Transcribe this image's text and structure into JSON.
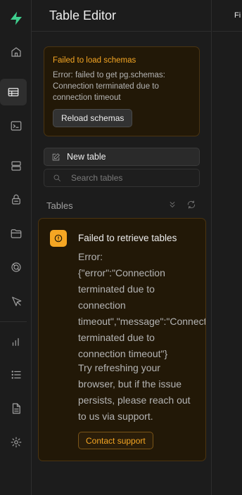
{
  "rail": {
    "items": [
      {
        "icon": "supabase-logo-icon"
      },
      {
        "icon": "home-icon"
      },
      {
        "icon": "table-editor-icon",
        "active": true
      },
      {
        "icon": "sql-editor-icon"
      },
      {
        "icon": "database-icon"
      },
      {
        "icon": "auth-lock-icon"
      },
      {
        "icon": "storage-folder-icon"
      },
      {
        "icon": "realtime-icon"
      },
      {
        "icon": "edge-functions-icon"
      },
      {
        "icon": "reports-icon"
      },
      {
        "icon": "logs-list-icon"
      },
      {
        "icon": "api-docs-icon"
      },
      {
        "icon": "settings-gear-icon"
      }
    ],
    "brand_color": "#3ecf8e"
  },
  "panel": {
    "title": "Table Editor",
    "schema_error": {
      "title": "Failed to load schemas",
      "message": "Error: failed to get pg.schemas: Connection terminated due to connection timeout",
      "reload_label": "Reload schemas"
    },
    "new_table_label": "New table",
    "search_placeholder": "Search tables",
    "tables_heading": "Tables",
    "tables_error": {
      "title": "Failed to retrieve tables",
      "message": "Error:\n{\"error\":\"Connection\nterminated due to\nconnection\ntimeout\",\"message\":\"Connection\nterminated due to\nconnection timeout\"}",
      "hint": "Try refreshing your browser, but if the issue persists, please reach out to us via support.",
      "contact_label": "Contact support"
    }
  },
  "right": {
    "tab_label": "Fi"
  },
  "colors": {
    "warning": "#f5a623",
    "background": "#1c1c1c"
  }
}
